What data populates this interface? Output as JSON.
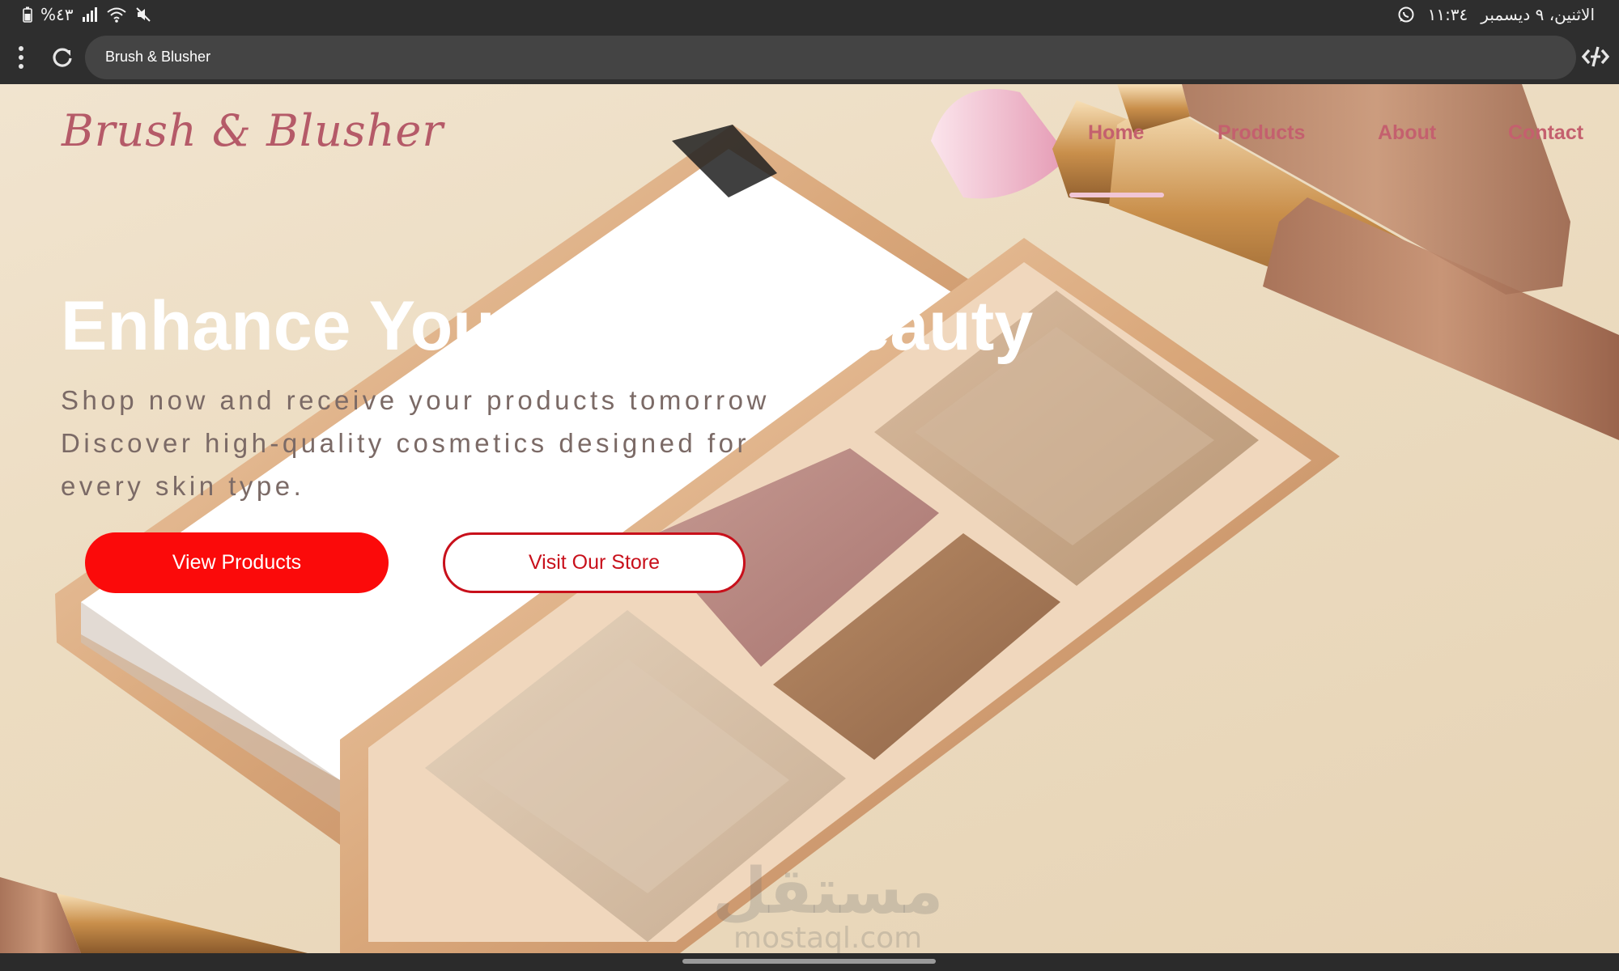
{
  "status_bar": {
    "battery": "%٤٣",
    "datetime": "الاثنين، ٩ ديسمبر",
    "time": "١١:٣٤",
    "icons": [
      "battery-icon",
      "signal-icon",
      "wifi-icon",
      "mute-icon",
      "whatsapp-icon"
    ]
  },
  "browser": {
    "url_text": "Brush & Blusher",
    "icons": [
      "menu-icon",
      "reload-icon",
      "code-icon"
    ]
  },
  "site": {
    "logo": "Brush & Blusher",
    "nav": {
      "home": "Home",
      "products": "Products",
      "about": "About",
      "contact": "Contact",
      "active": "Home"
    },
    "hero": {
      "title": "Enhance Your Natural Beauty",
      "subtitle": "Shop now and receive your products tomorrow Discover high-quality cosmetics designed for every skin type.",
      "primary_button": "View Products",
      "secondary_button": "Visit Our Store"
    },
    "watermark": {
      "arabic": "مستقل",
      "latin": "mostaql.com"
    }
  },
  "colors": {
    "brand": "#b55a68",
    "nav": "#c4606e",
    "primary_button": "#fb0a0a",
    "secondary_border": "#c8101b",
    "underline": "#f1c6d6"
  }
}
